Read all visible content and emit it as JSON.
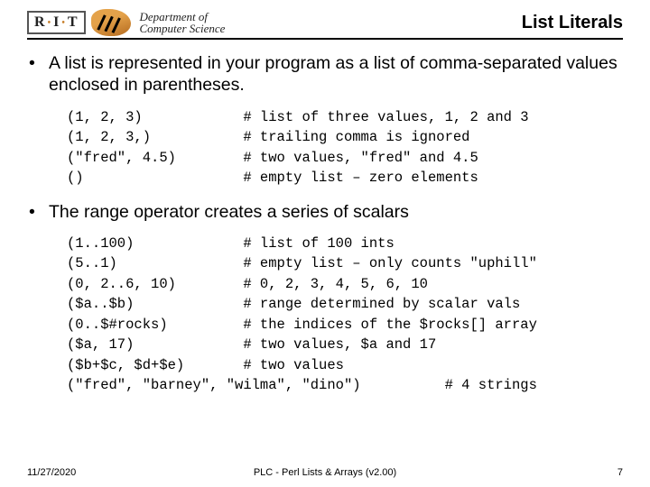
{
  "header": {
    "rit_letters": [
      "R",
      "I",
      "T"
    ],
    "dept_line1": "Department of",
    "dept_line2": "Computer Science",
    "title": "List Literals"
  },
  "bullets": {
    "b1": "A list is represented in your program as a list of comma-separated values enclosed in parentheses.",
    "b2": "The range operator creates a series of scalars"
  },
  "code1": "(1, 2, 3)            # list of three values, 1, 2 and 3\n(1, 2, 3,)           # trailing comma is ignored\n(\"fred\", 4.5)        # two values, \"fred\" and 4.5\n()                   # empty list – zero elements",
  "code2": "(1..100)             # list of 100 ints\n(5..1)               # empty list – only counts \"uphill\"\n(0, 2..6, 10)        # 0, 2, 3, 4, 5, 6, 10\n($a..$b)             # range determined by scalar vals\n(0..$#rocks)         # the indices of the $rocks[] array\n($a, 17)             # two values, $a and 17\n($b+$c, $d+$e)       # two values\n(\"fred\", \"barney\", \"wilma\", \"dino\")          # 4 strings",
  "footer": {
    "date": "11/27/2020",
    "center": "PLC - Perl Lists & Arrays (v2.00)",
    "page": "7"
  }
}
